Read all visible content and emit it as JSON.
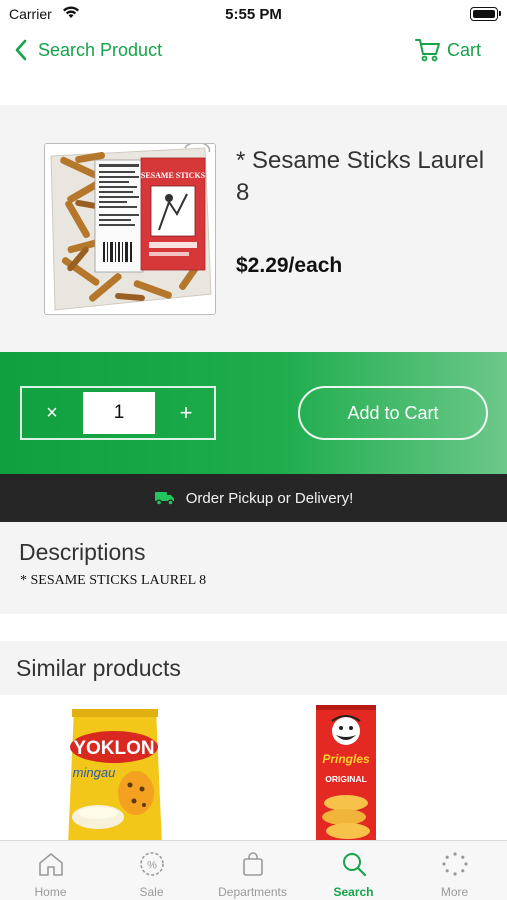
{
  "status_bar": {
    "carrier": "Carrier",
    "time": "5:55 PM"
  },
  "nav": {
    "back_label": "Search Product",
    "cart_label": "Cart"
  },
  "product": {
    "name": "* Sesame Sticks Laurel 8",
    "price": "$2.29/each",
    "image_label": "SESAME STICKS",
    "image_brand": "SESAME STICKS"
  },
  "quantity": {
    "minus": "×",
    "value": "1",
    "plus": "+"
  },
  "add_to_cart_label": "Add to Cart",
  "pickup_banner": "Order Pickup or Delivery!",
  "descriptions": {
    "title": "Descriptions",
    "text": "* SESAME STICKS LAUREL 8"
  },
  "similar": {
    "title": "Similar products",
    "items": [
      {
        "brand": "YOKLON",
        "sub": "mingau"
      },
      {
        "brand": "Pringles",
        "sub": "ORIGINAL"
      }
    ]
  },
  "tabs": [
    {
      "label": "Home",
      "icon": "home-icon"
    },
    {
      "label": "Sale",
      "icon": "sale-tag-icon"
    },
    {
      "label": "Departments",
      "icon": "shopping-bag-icon"
    },
    {
      "label": "Search",
      "icon": "search-icon",
      "active": true
    },
    {
      "label": "More",
      "icon": "more-dots-icon"
    }
  ],
  "colors": {
    "accent": "#16a34a",
    "band_start": "#10a040",
    "band_end": "#6cc88a",
    "banner": "#262626"
  }
}
